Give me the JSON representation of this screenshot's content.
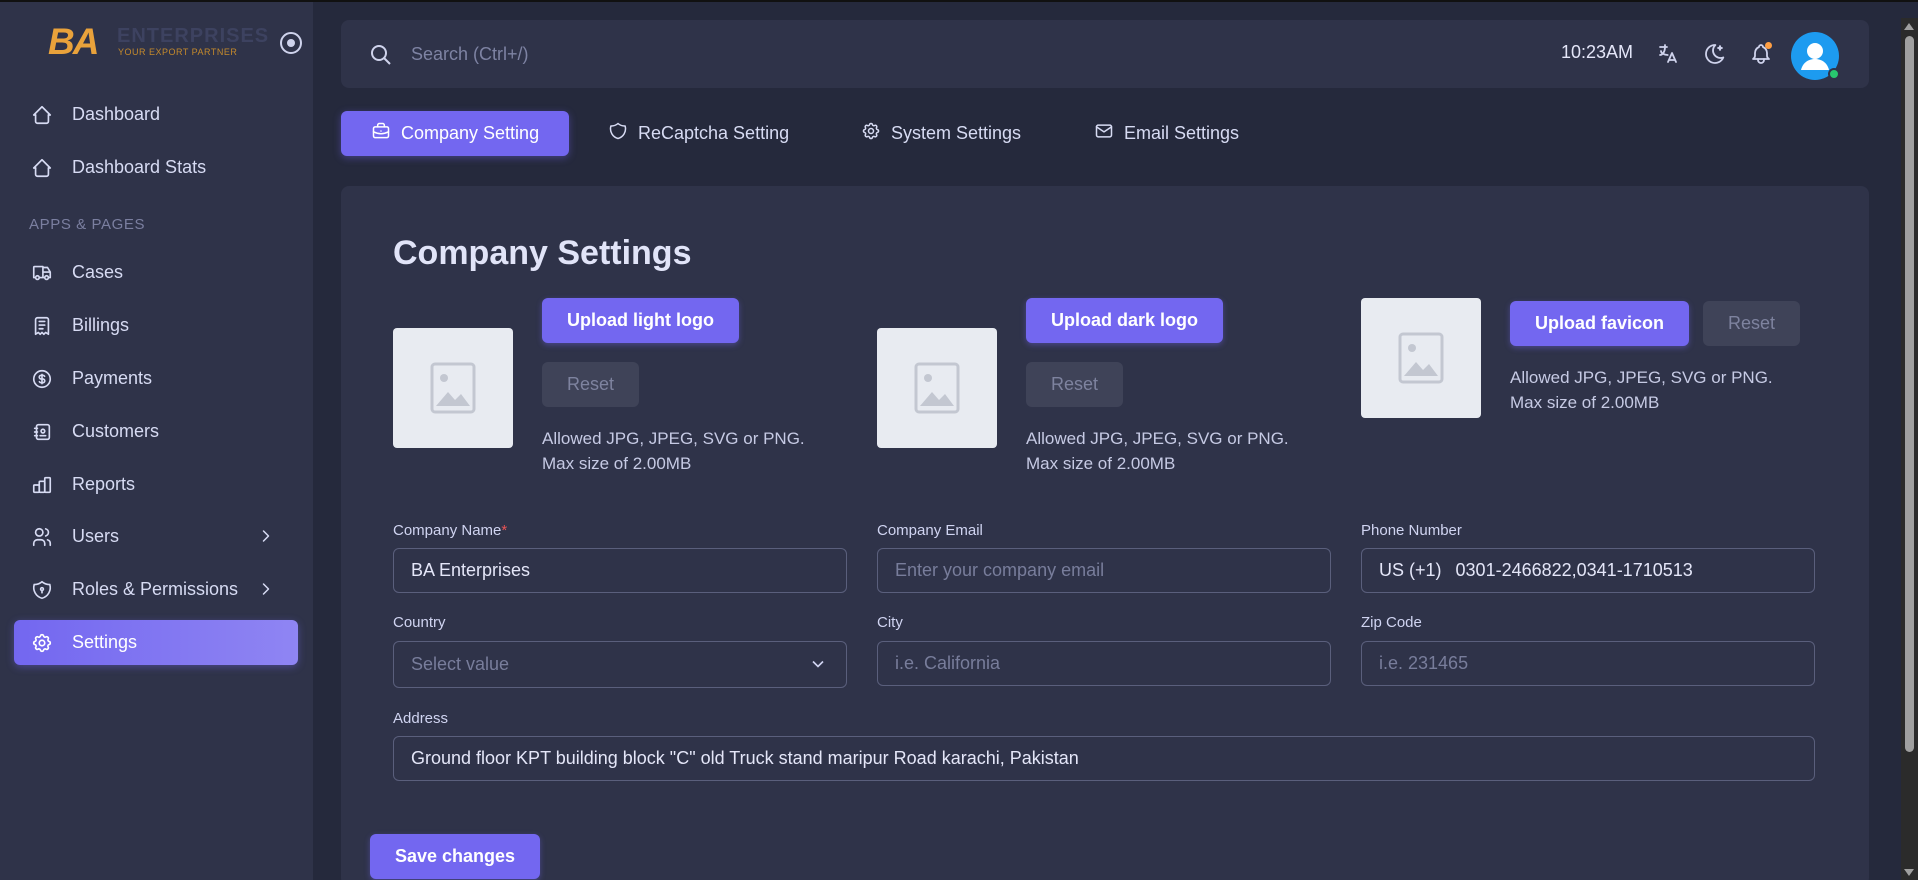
{
  "brand": {
    "short": "BA",
    "name": "ENTERPRISES",
    "tagline": "YOUR EXPORT PARTNER"
  },
  "sidebar": {
    "section_label": "APPS & PAGES",
    "items": [
      {
        "label": "Dashboard",
        "icon": "home-icon"
      },
      {
        "label": "Dashboard Stats",
        "icon": "home-icon"
      },
      {
        "label": "Cases",
        "icon": "truck-icon"
      },
      {
        "label": "Billings",
        "icon": "receipt-icon"
      },
      {
        "label": "Payments",
        "icon": "dollar-coin-icon"
      },
      {
        "label": "Customers",
        "icon": "contacts-book-icon"
      },
      {
        "label": "Reports",
        "icon": "bar-chart-icon"
      },
      {
        "label": "Users",
        "icon": "users-icon"
      },
      {
        "label": "Roles & Permissions",
        "icon": "shield-icon"
      },
      {
        "label": "Settings",
        "icon": "gear-icon"
      }
    ]
  },
  "header": {
    "search_placeholder": "Search (Ctrl+/)",
    "time": "10:23AM"
  },
  "tabs": [
    {
      "label": "Company Setting",
      "icon": "briefcase-icon"
    },
    {
      "label": "ReCaptcha Setting",
      "icon": "shield-icon"
    },
    {
      "label": "System Settings",
      "icon": "gear-icon"
    },
    {
      "label": "Email Settings",
      "icon": "mail-icon"
    }
  ],
  "card": {
    "title": "Company Settings",
    "uploads": {
      "light": {
        "button": "Upload light logo",
        "reset": "Reset",
        "hint1": "Allowed JPG, JPEG, SVG or PNG.",
        "hint2": "Max size of 2.00MB"
      },
      "dark": {
        "button": "Upload dark logo",
        "reset": "Reset",
        "hint1": "Allowed JPG, JPEG, SVG or PNG.",
        "hint2": "Max size of 2.00MB"
      },
      "favicon": {
        "button": "Upload favicon",
        "reset": "Reset",
        "hint1": "Allowed JPG, JPEG, SVG or PNG.",
        "hint2": "Max size of 2.00MB"
      }
    },
    "form": {
      "company_name": {
        "label": "Company Name",
        "required_mark": "*",
        "value": "BA Enterprises"
      },
      "company_email": {
        "label": "Company Email",
        "placeholder": "Enter your company email"
      },
      "phone": {
        "label": "Phone Number",
        "prefix": "US (+1)",
        "value": "0301-2466822,0341-1710513"
      },
      "country": {
        "label": "Country",
        "placeholder": "Select value"
      },
      "city": {
        "label": "City",
        "placeholder": "i.e. California"
      },
      "zip": {
        "label": "Zip Code",
        "placeholder": "i.e. 231465"
      },
      "address": {
        "label": "Address",
        "value": "Ground floor KPT building block \"C\" old Truck stand maripur Road karachi, Pakistan"
      }
    },
    "save_label": "Save changes"
  },
  "colors": {
    "accent": "#7367f0",
    "background": "#25293c",
    "surface": "#2f3349",
    "brand_orange": "#e9a23b"
  }
}
